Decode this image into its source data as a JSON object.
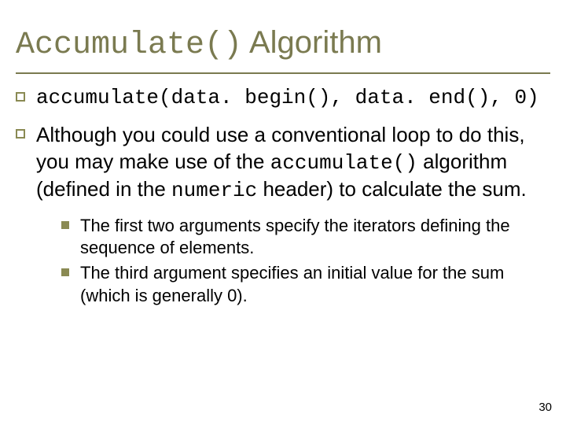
{
  "title": {
    "code": "Accumulate()",
    "word": "Algorithm"
  },
  "bullets": [
    {
      "kind": "code",
      "text": "accumulate(data. begin(), data. end(), 0)"
    },
    {
      "kind": "mixed",
      "parts": {
        "t1": "Although you could use a conventional loop to do this, you may make use of the ",
        "c1": "accumulate()",
        "t2": " algorithm (defined in the ",
        "c2": "numeric",
        "t3": " header) to calculate the sum."
      },
      "sub": [
        "The first two arguments specify the iterators defining the sequence of elements.",
        "The third argument specifies an initial value for the sum (which is generally 0)."
      ]
    }
  ],
  "page_number": "30"
}
